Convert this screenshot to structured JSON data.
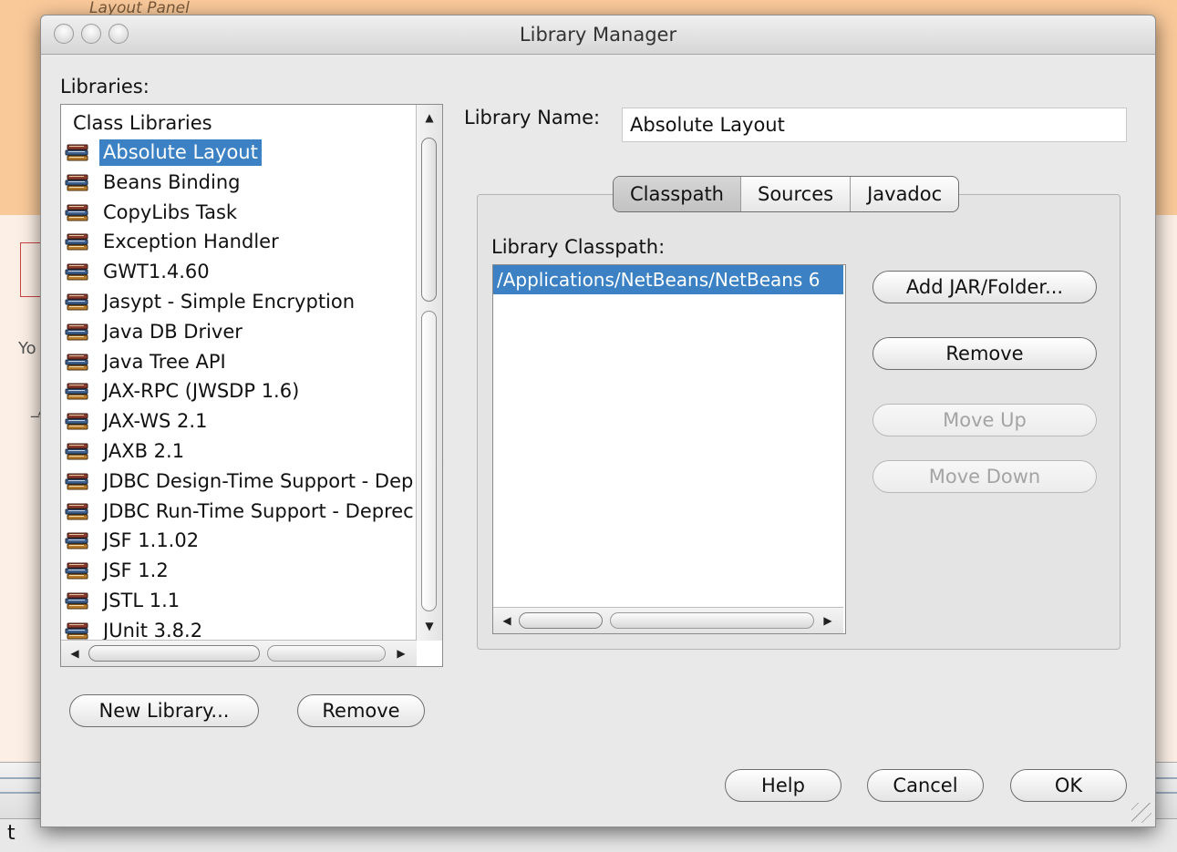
{
  "background": {
    "page_title": "Layout Panel",
    "fragment_yo": "Yo",
    "fragment_link": "_/",
    "status_fragment": "t"
  },
  "dialog": {
    "title": "Library Manager",
    "libraries_label": "Libraries:",
    "category_header": "Class Libraries",
    "libraries": [
      "Absolute Layout",
      "Beans Binding",
      "CopyLibs Task",
      "Exception Handler",
      "GWT1.4.60",
      "Jasypt - Simple Encryption",
      "Java DB Driver",
      "Java Tree API",
      "JAX-RPC (JWSDP 1.6)",
      "JAX-WS 2.1",
      "JAXB 2.1",
      "JDBC Design-Time Support - Deprecated",
      "JDBC Run-Time Support - Deprecated",
      "JSF 1.1.02",
      "JSF 1.2",
      "JSTL 1.1",
      "JUnit 3.8.2"
    ],
    "selected_library": "Absolute Layout",
    "new_library_button": "New Library...",
    "remove_library_button": "Remove",
    "library_name_label": "Library Name:",
    "library_name_value": "Absolute Layout",
    "tabs": [
      "Classpath",
      "Sources",
      "Javadoc"
    ],
    "active_tab": "Classpath",
    "classpath_label": "Library Classpath:",
    "classpath_entries": [
      "/Applications/NetBeans/NetBeans 6"
    ],
    "add_jar_button": "Add JAR/Folder...",
    "remove_entry_button": "Remove",
    "move_up_button": "Move Up",
    "move_down_button": "Move Down",
    "help_button": "Help",
    "cancel_button": "Cancel",
    "ok_button": "OK"
  },
  "colors": {
    "selection": "#3b81c4",
    "background_header": "#f9c99a",
    "dialog_bg": "#e9e9e9"
  }
}
